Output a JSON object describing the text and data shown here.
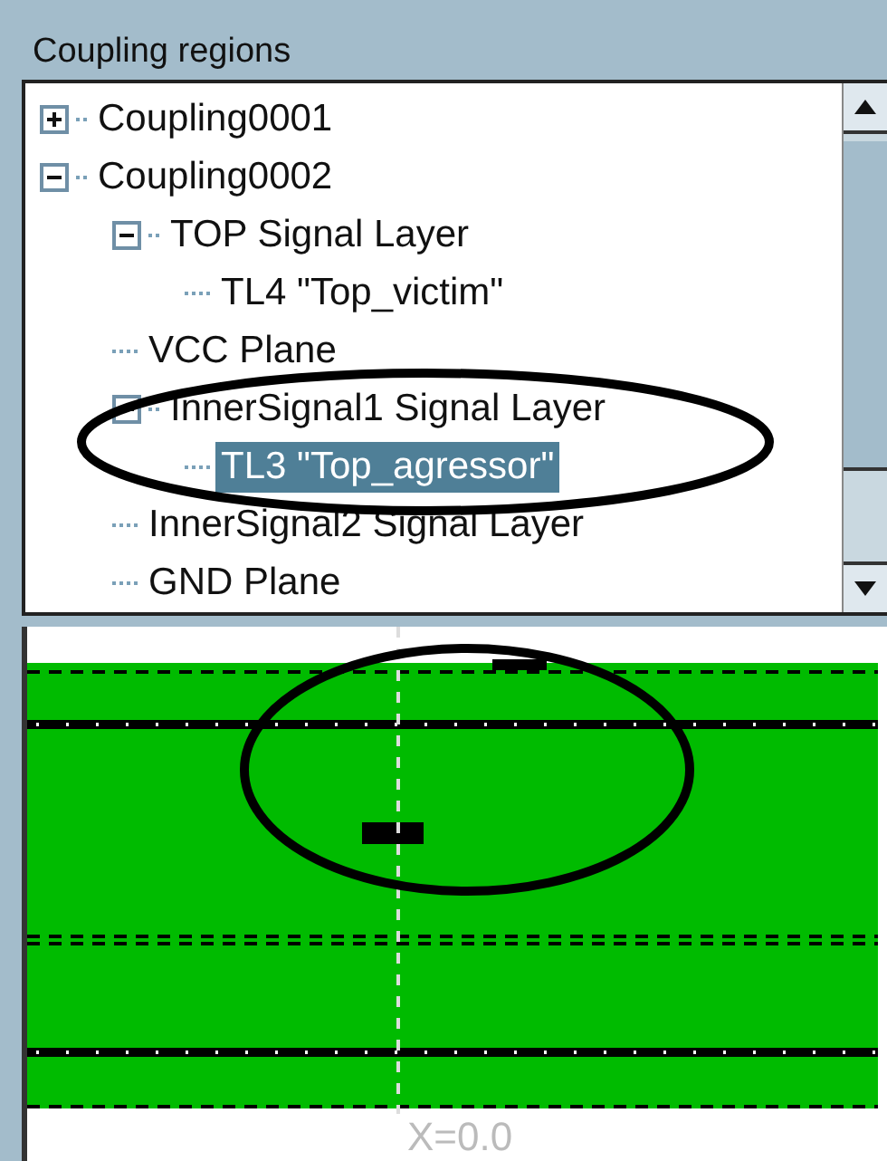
{
  "panel": {
    "title": "Coupling regions"
  },
  "tree": [
    {
      "label": "Coupling0001",
      "expanded": false,
      "selected": false
    },
    {
      "label": "Coupling0002",
      "expanded": true,
      "selected": false,
      "children": [
        {
          "label": "TOP Signal Layer",
          "expanded": true,
          "selected": false,
          "children": [
            {
              "label": "TL4 \"Top_victim\"",
              "selected": false
            }
          ]
        },
        {
          "label": "VCC Plane",
          "selected": false
        },
        {
          "label": "InnerSignal1 Signal Layer",
          "expanded": true,
          "selected": false,
          "children": [
            {
              "label": "TL3 \"Top_agressor\"",
              "selected": true
            }
          ]
        },
        {
          "label": "InnerSignal2 Signal Layer",
          "selected": false
        },
        {
          "label": "GND Plane",
          "selected": false
        }
      ]
    }
  ],
  "cross_section": {
    "cursor_label": "X=0.0"
  }
}
